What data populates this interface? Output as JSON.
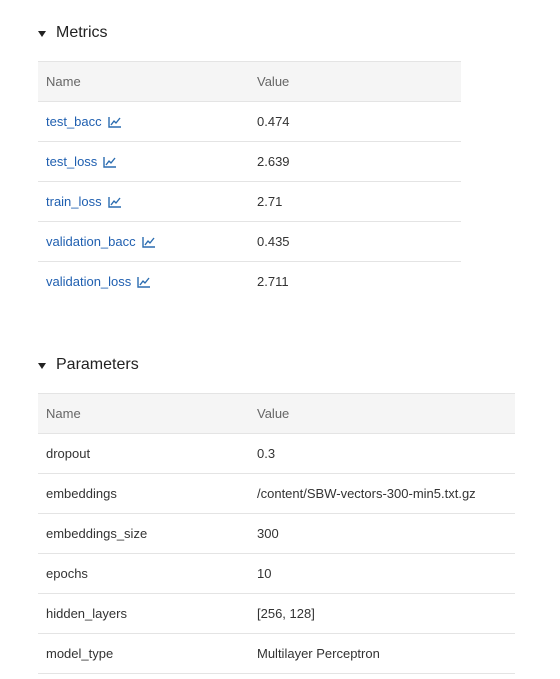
{
  "metrics": {
    "title": "Metrics",
    "columns": [
      "Name",
      "Value"
    ],
    "rows": [
      {
        "name": "test_bacc",
        "value": "0.474"
      },
      {
        "name": "test_loss",
        "value": "2.639"
      },
      {
        "name": "train_loss",
        "value": "2.71"
      },
      {
        "name": "validation_bacc",
        "value": "0.435"
      },
      {
        "name": "validation_loss",
        "value": "2.711"
      }
    ],
    "icon": "line-chart-icon",
    "link_color": "#2b6cb0"
  },
  "parameters": {
    "title": "Parameters",
    "columns": [
      "Name",
      "Value"
    ],
    "rows": [
      {
        "name": "dropout",
        "value": "0.3"
      },
      {
        "name": "embeddings",
        "value": "/content/SBW-vectors-300-min5.txt.gz"
      },
      {
        "name": "embeddings_size",
        "value": "300"
      },
      {
        "name": "epochs",
        "value": "10"
      },
      {
        "name": "hidden_layers",
        "value": "[256, 128]"
      },
      {
        "name": "model_type",
        "value": "Multilayer Perceptron"
      }
    ]
  },
  "colors": {
    "header_bg": "#f5f5f5",
    "border": "#e4e4e4"
  }
}
